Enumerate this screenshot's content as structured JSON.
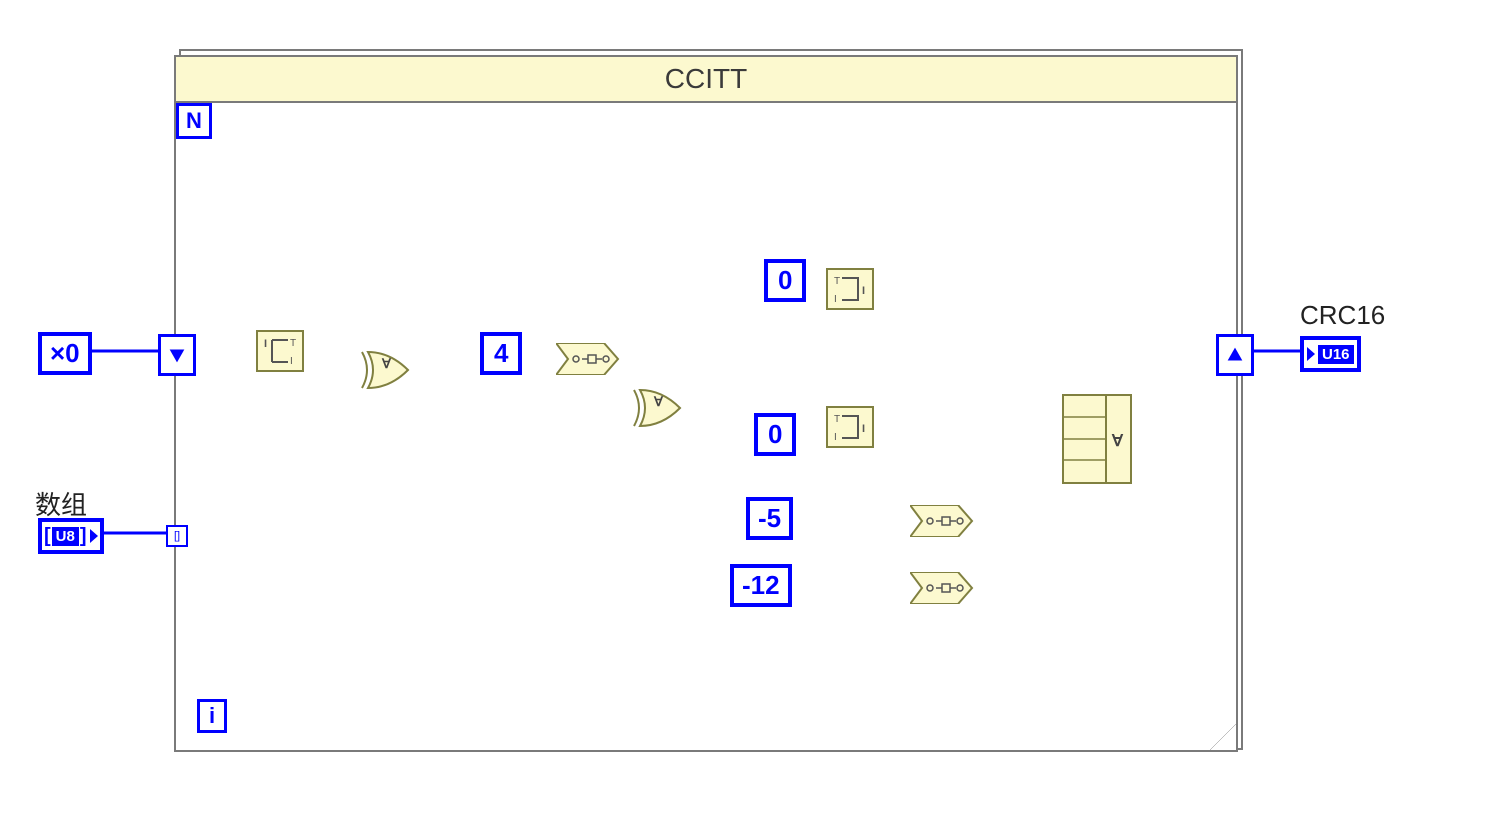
{
  "case_title": "CCITT",
  "n_label": "N",
  "i_label": "i",
  "init_const": "×0",
  "array_label": "数组",
  "array_type": "U8",
  "output_label": "CRC16",
  "output_type": "U16",
  "constants": {
    "c4": "4",
    "c0a": "0",
    "c0b": "0",
    "cm5": "-5",
    "cm12": "-12"
  },
  "nodes": {
    "split1": "split-number",
    "split2": "split-number",
    "split3": "split-number",
    "xor1": "xor",
    "xor2": "xor",
    "rotate1": "rotate",
    "rotate2": "rotate",
    "rotate3": "rotate",
    "compound_xor": "compound-xor"
  }
}
